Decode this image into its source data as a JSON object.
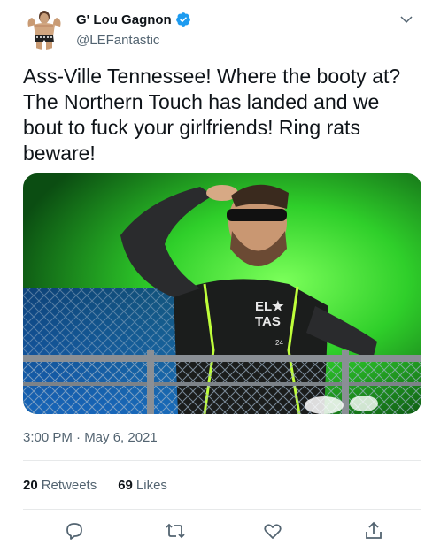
{
  "author": {
    "name": "G' Lou Gagnon",
    "handle": "@LEFantastic",
    "verified": true
  },
  "tweet": {
    "text": "Ass-Ville Tennessee! Where the booty at? The Northern Touch has landed and we bout to fuck your girlfriends! Ring rats beware!",
    "timestamp": "3:00 PM · May 6, 2021",
    "media_overlay_text": {
      "shirt_top": "EL★",
      "shirt_bottom": "TAS",
      "shirt_number": "24"
    }
  },
  "stats": {
    "retweets_count": "20",
    "retweets_label": "Retweets",
    "likes_count": "69",
    "likes_label": "Likes"
  },
  "icons": {
    "verified": "verified-badge-icon",
    "more": "chevron-down-icon",
    "reply": "reply-icon",
    "retweet": "retweet-icon",
    "like": "heart-icon",
    "share": "share-icon"
  },
  "colors": {
    "accent": "#1d9bf0",
    "text": "#0f1419",
    "secondary": "#536471",
    "divider": "#e7e9ea"
  }
}
